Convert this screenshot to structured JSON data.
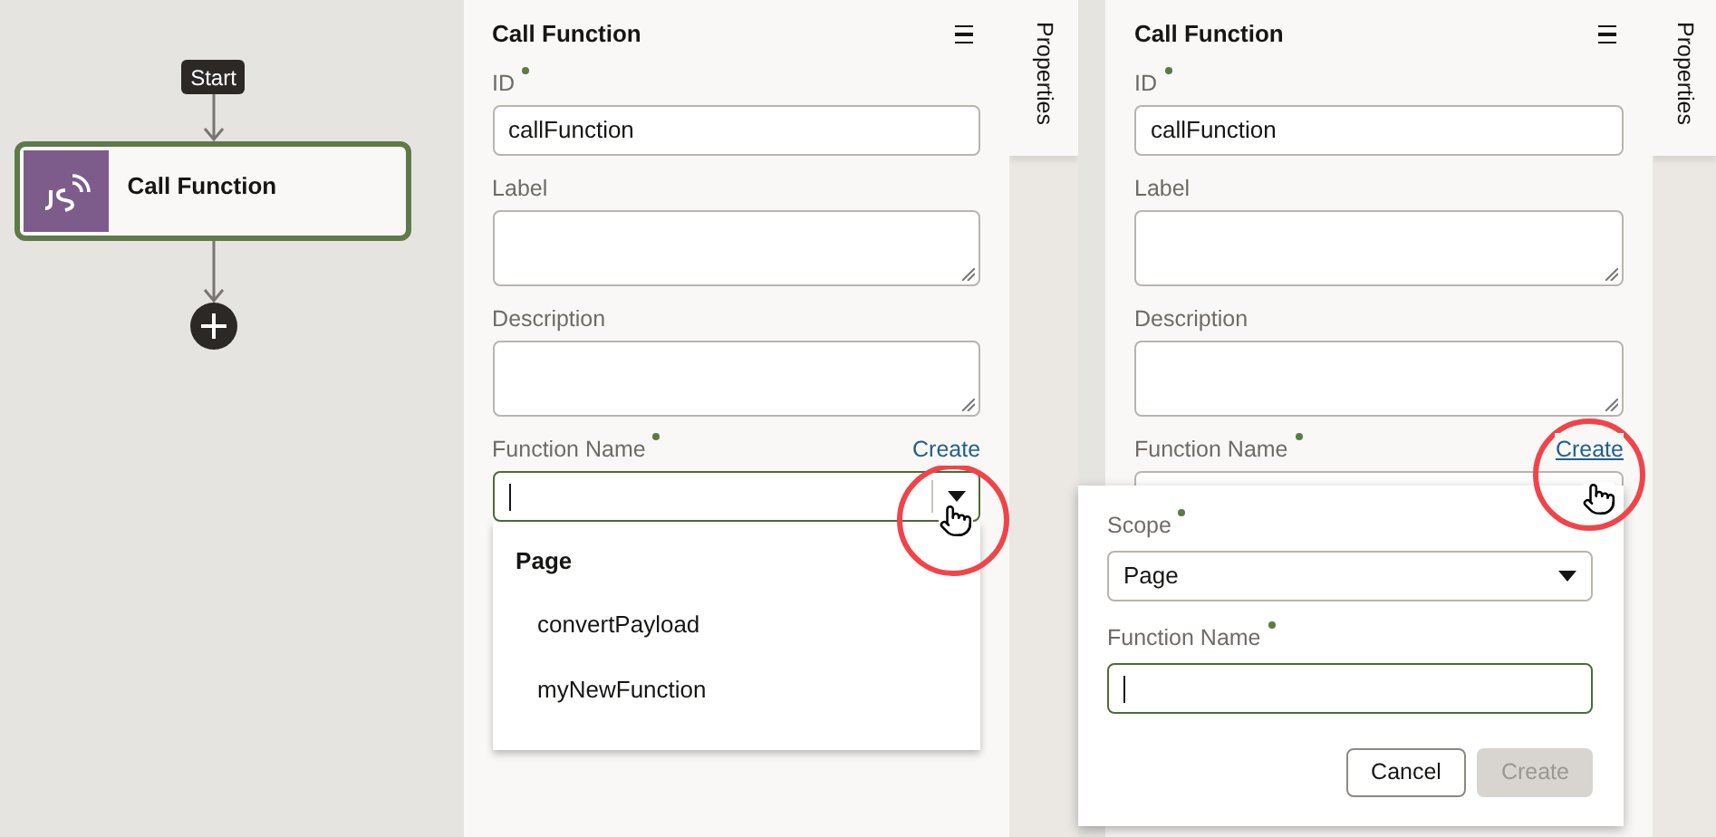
{
  "canvas": {
    "start": "Start",
    "node": {
      "title": "Call Function"
    }
  },
  "panels": [
    {
      "title": "Call Function",
      "side_tab": {
        "label": "Properties",
        "selected": true
      },
      "fields": [
        {
          "kind": "input",
          "label": "ID",
          "required": true,
          "value": "callFunction"
        },
        {
          "kind": "textarea",
          "label": "Label",
          "required": false
        },
        {
          "kind": "textarea",
          "label": "Description",
          "required": false
        },
        {
          "kind": "combobox",
          "label": "Function Name",
          "required": true,
          "focused": true,
          "link": {
            "label": "Create",
            "hovered": false
          }
        }
      ],
      "dropdown": {
        "group": "Page",
        "options": [
          "convertPayload",
          "myNewFunction"
        ]
      }
    },
    {
      "title": "Call Function",
      "side_tab": {
        "label": "Properties",
        "selected": true
      },
      "fields": [
        {
          "kind": "input",
          "label": "ID",
          "required": true,
          "value": "callFunction"
        },
        {
          "kind": "textarea",
          "label": "Label",
          "required": false
        },
        {
          "kind": "textarea",
          "label": "Description",
          "required": false
        },
        {
          "kind": "combobox",
          "label": "Function Name",
          "required": true,
          "focused": false,
          "link": {
            "label": "Create",
            "hovered": true
          }
        }
      ],
      "popup": {
        "fields": [
          {
            "kind": "select",
            "label": "Scope",
            "required": true,
            "value": "Page"
          },
          {
            "kind": "input",
            "label": "Function Name",
            "required": true,
            "focused": true
          }
        ],
        "buttons": [
          {
            "label": "Cancel",
            "disabled": false
          },
          {
            "label": "Create",
            "disabled": true
          }
        ]
      }
    }
  ]
}
